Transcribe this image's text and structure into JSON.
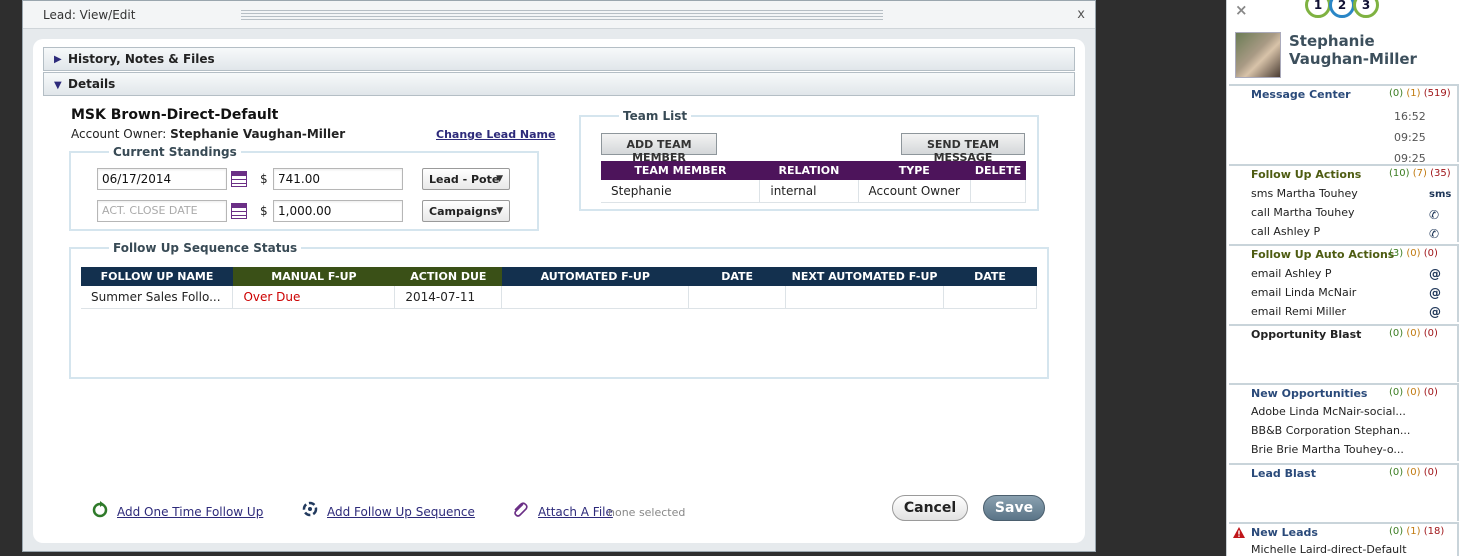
{
  "dialog": {
    "title": "Lead: View/Edit",
    "close": "x",
    "sections": {
      "history": "History, Notes & Files",
      "details": "Details"
    }
  },
  "lead": {
    "name": "MSK Brown-Direct-Default",
    "owner_label": "Account Owner:",
    "owner_name": "Stephanie Vaughan-Miller",
    "change_name_link": "Change Lead Name"
  },
  "standings": {
    "legend": "Current Standings",
    "row1": {
      "date": "06/17/2014",
      "currency": "$",
      "amount": "741.00",
      "select": "Lead - Pote"
    },
    "row2": {
      "date_placeholder": "ACT. CLOSE DATE",
      "currency": "$",
      "amount": "1,000.00",
      "select": "Campaigns"
    }
  },
  "team": {
    "legend": "Team List",
    "add_button": "ADD TEAM MEMBER",
    "send_button": "SEND TEAM MESSAGE",
    "headers": [
      "TEAM MEMBER",
      "RELATION",
      "TYPE",
      "DELETE"
    ],
    "rows": [
      [
        "Stephanie",
        "internal",
        "Account Owner",
        ""
      ]
    ]
  },
  "followup": {
    "legend": "Follow Up Sequence Status",
    "headers": [
      "FOLLOW UP NAME",
      "MANUAL F-UP",
      "ACTION DUE",
      "AUTOMATED F-UP",
      "DATE",
      "NEXT AUTOMATED F-UP",
      "DATE"
    ],
    "rows": [
      [
        "Summer Sales Follo...",
        "Over Due",
        "2014-07-11",
        "",
        "",
        "",
        ""
      ]
    ]
  },
  "footer": {
    "add_one_time": "Add One Time Follow Up",
    "add_sequence": "Add Follow Up Sequence",
    "attach_file": "Attach A File",
    "none_selected": "none selected",
    "cancel": "Cancel",
    "save": "Save"
  },
  "panel": {
    "close": "×",
    "logo": [
      "1",
      "2",
      "3"
    ],
    "user_name": "Stephanie Vaughan-Miller",
    "message_center": {
      "title": "Message Center",
      "counts": [
        "(0)",
        "(1)",
        "(519)"
      ],
      "times": [
        "16:52",
        "09:25",
        "09:25"
      ]
    },
    "follow_up_actions": {
      "title": "Follow Up Actions",
      "counts": [
        "(10)",
        "(7)",
        "(35)"
      ],
      "items": [
        "sms Martha Touhey",
        "call Martha Touhey",
        "call Ashley P"
      ],
      "icons": [
        "sms",
        "phone-icon",
        "phone-icon"
      ]
    },
    "follow_up_auto": {
      "title": "Follow Up Auto Actions",
      "counts": [
        "(3)",
        "(0)",
        "(0)"
      ],
      "items": [
        "email Ashley P",
        "email Linda McNair",
        "email Remi Miller"
      ],
      "icon": "@"
    },
    "opportunity_blast": {
      "title": "Opportunity Blast",
      "counts": [
        "(0)",
        "(0)",
        "(0)"
      ]
    },
    "new_opportunities": {
      "title": "New Opportunities",
      "counts": [
        "(0)",
        "(0)",
        "(0)"
      ],
      "items": [
        "Adobe Linda McNair-social...",
        "BB&B Corporation Stephan...",
        "Brie Brie Martha Touhey-o..."
      ]
    },
    "lead_blast": {
      "title": "Lead Blast",
      "counts": [
        "(0)",
        "(0)",
        "(0)"
      ]
    },
    "new_leads": {
      "title": "New Leads",
      "counts": [
        "(0)",
        "(1)",
        "(18)"
      ],
      "items": [
        "Michelle Laird-direct-Default"
      ]
    }
  },
  "colors": {
    "team_header": "#4d145b",
    "followup_header": "#13304e",
    "manual_header": "#3a5017",
    "overdue": "#cc0000"
  }
}
